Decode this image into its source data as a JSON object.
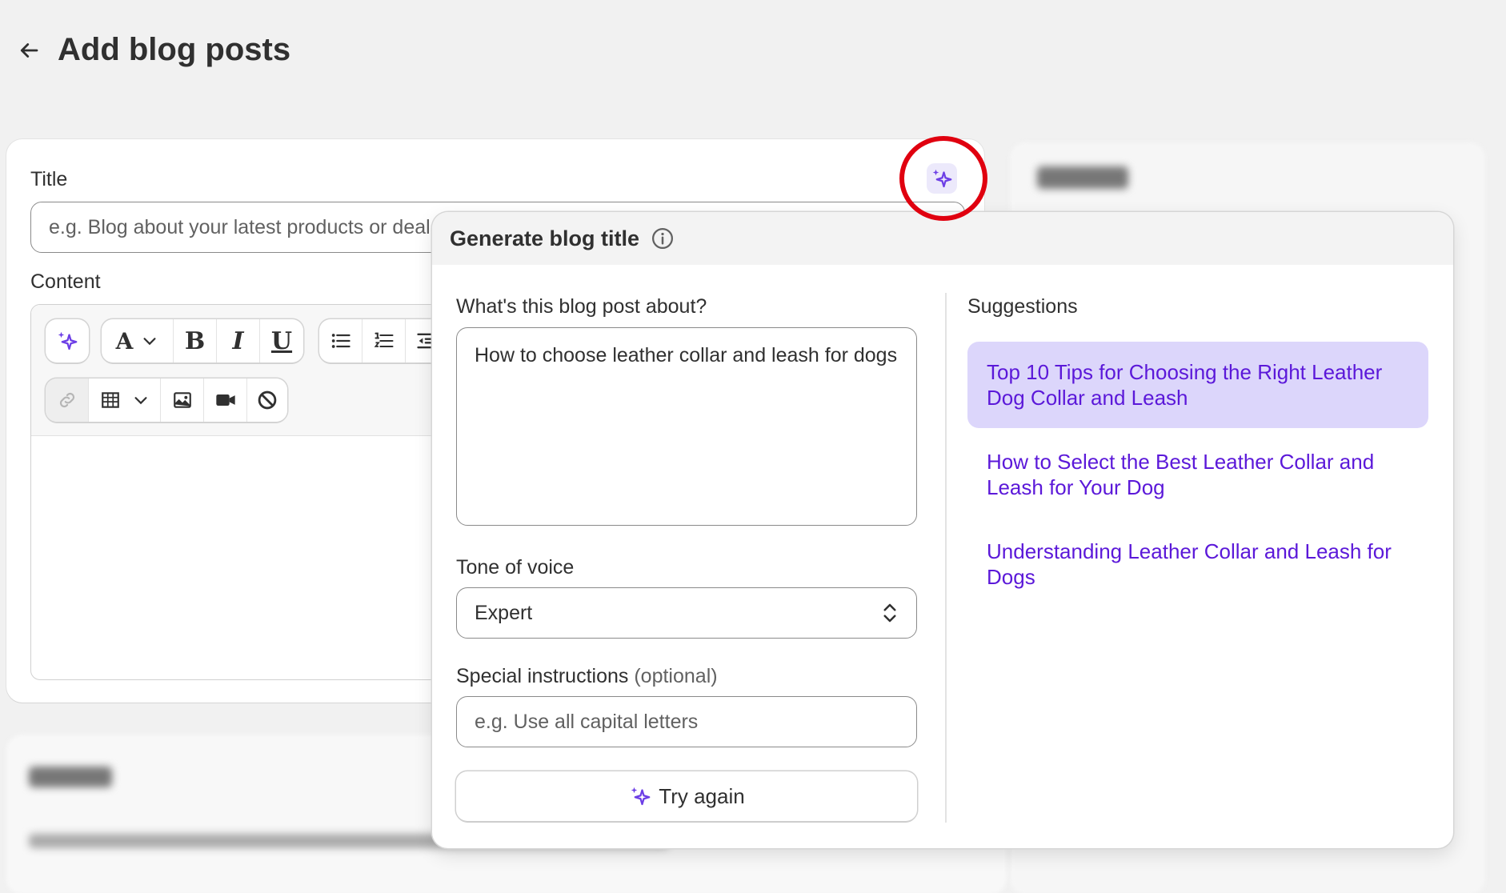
{
  "page": {
    "title": "Add blog posts"
  },
  "form": {
    "title_label": "Title",
    "title_placeholder": "e.g. Blog about your latest products or deals",
    "content_label": "Content"
  },
  "toolbar": {
    "font_label": "A",
    "bold_label": "B",
    "italic_label": "I",
    "underline_label": "U"
  },
  "popover": {
    "title": "Generate blog title",
    "about_label": "What's this blog post about?",
    "about_value": "How to choose leather collar and leash for dogs",
    "tone_label": "Tone of voice",
    "tone_value": "Expert",
    "instructions_label": "Special instructions",
    "instructions_optional": "(optional)",
    "instructions_placeholder": "e.g. Use all capital letters",
    "try_again_label": "Try again",
    "suggestions_label": "Suggestions",
    "suggestions": [
      "Top 10 Tips for Choosing the Right Leather Dog Collar and Leash",
      "How to Select the Best Leather Collar and Leash for Your Dog",
      "Understanding Leather Collar and Leash for Dogs"
    ]
  },
  "colors": {
    "accent": "#5b18d9",
    "selected_bg": "#dcd6fb",
    "highlight_ring": "#e0000f",
    "page_bg": "#f1f1f1"
  },
  "icons": [
    "back-arrow-icon",
    "sparkle-icon",
    "info-icon",
    "list-bullet-icon",
    "list-numbered-icon",
    "indent-icon",
    "link-icon",
    "table-icon",
    "image-icon",
    "video-icon",
    "clear-format-icon",
    "chevron-down-icon",
    "select-chevron-icon"
  ]
}
